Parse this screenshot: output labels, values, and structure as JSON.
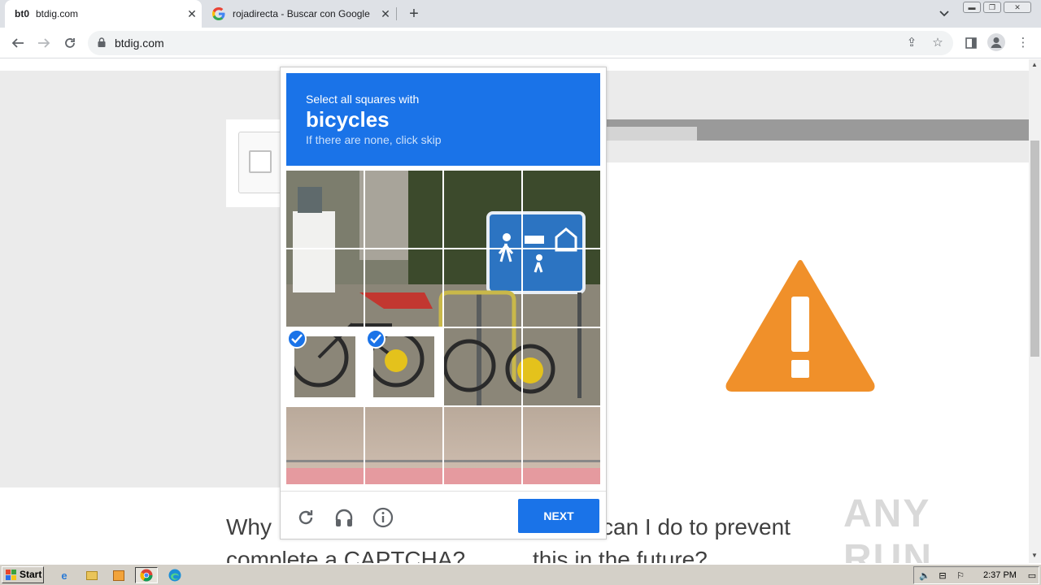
{
  "browser": {
    "tabs": [
      {
        "title": "btdig.com",
        "favicon": "bt0",
        "active": true
      },
      {
        "title": "rojadirecta - Buscar con Google",
        "favicon": "google-g",
        "active": false
      }
    ],
    "url": "btdig.com"
  },
  "captcha": {
    "instruction": "Select all squares with",
    "target": "bicycles",
    "hint": "If there are none, click skip",
    "next_label": "NEXT",
    "selected_tiles": [
      8,
      9
    ],
    "colors": {
      "header": "#1a73e8",
      "button": "#1a73e8"
    }
  },
  "page": {
    "why_line1": "Why",
    "why_line2": "complete a CAPTCHA?",
    "what_line1": "can I do to prevent",
    "what_line2": "this in the future?",
    "warning_color": "#f0902a"
  },
  "watermark": "ANY RUN",
  "taskbar": {
    "start_label": "Start",
    "clock": "2:37 PM"
  }
}
